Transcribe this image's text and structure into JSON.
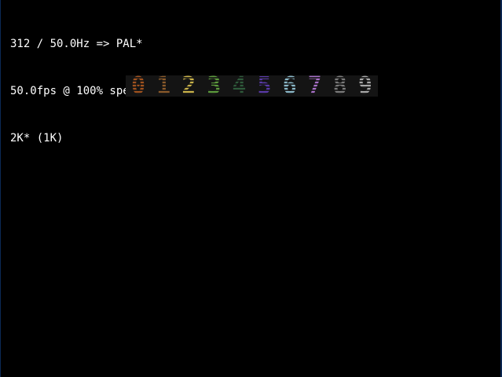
{
  "osd": {
    "line1": "312 / 50.0Hz => PAL*",
    "line2": "50.0fps @ 100% speed",
    "line3": "2K* (1K)"
  },
  "colors": {
    "background": "#000000",
    "osd_text": "#ffffff",
    "strip_background": "#141414"
  },
  "digits": [
    {
      "label": "0",
      "color": "#a0521e"
    },
    {
      "label": "1",
      "color": "#8a5a2a"
    },
    {
      "label": "2",
      "color": "#c9b24a"
    },
    {
      "label": "3",
      "color": "#5c9a3c"
    },
    {
      "label": "4",
      "color": "#2e5a3a"
    },
    {
      "label": "5",
      "color": "#5a3aa8"
    },
    {
      "label": "6",
      "color": "#8ab8c8"
    },
    {
      "label": "7",
      "color": "#a870c8"
    },
    {
      "label": "8",
      "color": "#7a7a7a"
    },
    {
      "label": "9",
      "color": "#a8a8a8"
    }
  ]
}
